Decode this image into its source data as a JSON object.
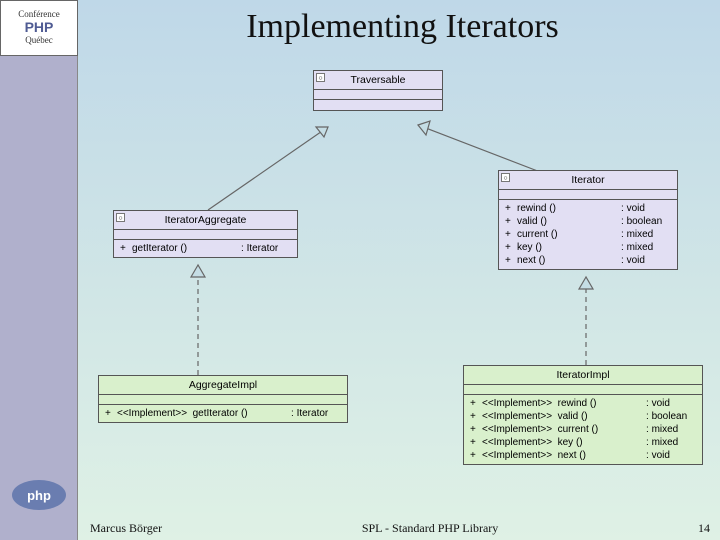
{
  "conference": {
    "top": "Conférence",
    "bottom": "Québec",
    "brand": "PHP"
  },
  "php_logo": "php",
  "title": "Implementing Iterators",
  "footer": {
    "author": "Marcus Börger",
    "center": "SPL - Standard PHP Library",
    "page": "14"
  },
  "uml": {
    "traversable": {
      "name": "Traversable",
      "sections": [
        "",
        ""
      ]
    },
    "iterator_aggregate": {
      "name": "IteratorAggregate",
      "methods": [
        {
          "vis": "+",
          "name": "getIterator ()",
          "ret": "Iterator"
        }
      ]
    },
    "iterator": {
      "name": "Iterator",
      "methods": [
        {
          "vis": "+",
          "name": "rewind ()",
          "ret": "void"
        },
        {
          "vis": "+",
          "name": "valid ()",
          "ret": "boolean"
        },
        {
          "vis": "+",
          "name": "current ()",
          "ret": "mixed"
        },
        {
          "vis": "+",
          "name": "key ()",
          "ret": "mixed"
        },
        {
          "vis": "+",
          "name": "next ()",
          "ret": "void"
        }
      ]
    },
    "aggregate_impl": {
      "name": "AggregateImpl",
      "methods": [
        {
          "vis": "+",
          "stereo": "<<Implement>>",
          "name": "getIterator ()",
          "ret": "Iterator"
        }
      ]
    },
    "iterator_impl": {
      "name": "IteratorImpl",
      "methods": [
        {
          "vis": "+",
          "stereo": "<<Implement>>",
          "name": "rewind ()",
          "ret": "void"
        },
        {
          "vis": "+",
          "stereo": "<<Implement>>",
          "name": "valid ()",
          "ret": "boolean"
        },
        {
          "vis": "+",
          "stereo": "<<Implement>>",
          "name": "current ()",
          "ret": "mixed"
        },
        {
          "vis": "+",
          "stereo": "<<Implement>>",
          "name": "key ()",
          "ret": "mixed"
        },
        {
          "vis": "+",
          "stereo": "<<Implement>>",
          "name": "next ()",
          "ret": "void"
        }
      ]
    }
  },
  "chart_data": {
    "type": "table",
    "description": "UML diagram: AggregateImpl realizes IteratorAggregate which extends Traversable; IteratorImpl realizes Iterator which extends Traversable.",
    "nodes": [
      {
        "id": "Traversable",
        "kind": "interface",
        "methods": []
      },
      {
        "id": "IteratorAggregate",
        "kind": "interface",
        "methods": [
          [
            "getIterator()",
            "Iterator"
          ]
        ]
      },
      {
        "id": "Iterator",
        "kind": "interface",
        "methods": [
          [
            "rewind()",
            "void"
          ],
          [
            "valid()",
            "boolean"
          ],
          [
            "current()",
            "mixed"
          ],
          [
            "key()",
            "mixed"
          ],
          [
            "next()",
            "void"
          ]
        ]
      },
      {
        "id": "AggregateImpl",
        "kind": "class",
        "implements": "IteratorAggregate",
        "methods": [
          [
            "getIterator()",
            "Iterator"
          ]
        ]
      },
      {
        "id": "IteratorImpl",
        "kind": "class",
        "implements": "Iterator",
        "methods": [
          [
            "rewind()",
            "void"
          ],
          [
            "valid()",
            "boolean"
          ],
          [
            "current()",
            "mixed"
          ],
          [
            "key()",
            "mixed"
          ],
          [
            "next()",
            "void"
          ]
        ]
      }
    ],
    "edges": [
      {
        "from": "IteratorAggregate",
        "to": "Traversable",
        "type": "generalization"
      },
      {
        "from": "Iterator",
        "to": "Traversable",
        "type": "generalization"
      },
      {
        "from": "AggregateImpl",
        "to": "IteratorAggregate",
        "type": "realization"
      },
      {
        "from": "IteratorImpl",
        "to": "Iterator",
        "type": "realization"
      }
    ]
  }
}
